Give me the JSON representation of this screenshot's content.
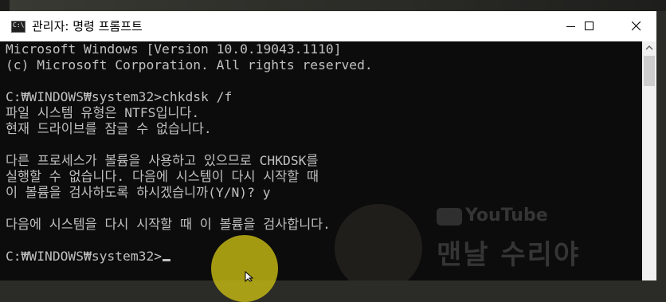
{
  "window": {
    "title": "관리자: 명령 프롬프트",
    "icon": "cmd-icon",
    "controls": [
      "minimize-icon",
      "maximize-icon",
      "close-icon"
    ]
  },
  "console": {
    "lines": [
      "Microsoft Windows [Version 10.0.19043.1110]",
      "(c) Microsoft Corporation. All rights reserved.",
      "",
      "C:₩WINDOWS₩system32>chkdsk /f",
      "파일 시스템 유형은 NTFS입니다.",
      "현재 드라이브를 잠글 수 없습니다.",
      "",
      "다른 프로세스가 볼륨을 사용하고 있으므로 CHKDSK를",
      "실행할 수 없습니다. 다음에 시스템이 다시 시작할 때",
      "이 볼륨을 검사하도록 하시겠습니까(Y/N)? y",
      "",
      "다음에 시스템을 다시 시작할 때 이 볼륨을 검사합니다.",
      "",
      "C:₩WINDOWS₩system32>"
    ],
    "text_color": "#c0c0c0",
    "background": "#0c0c0c"
  },
  "watermark": {
    "platform": "YouTube",
    "channel": "맨날 수리야"
  },
  "colors": {
    "titlebar": "#ffffff",
    "cursor_highlight": "#c8bc1a"
  }
}
